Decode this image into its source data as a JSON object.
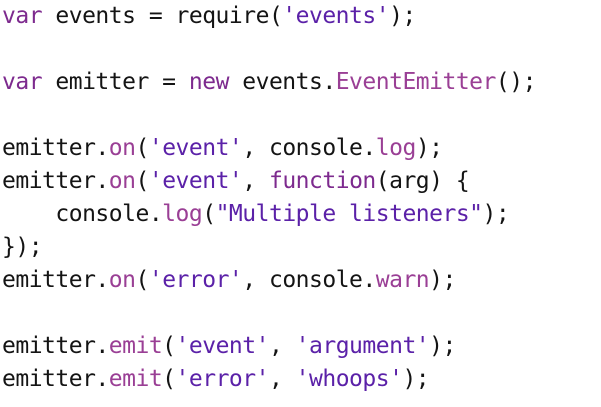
{
  "colors": {
    "background": "#ffffff",
    "plain": "#141414",
    "keyword": "#7d2a8e",
    "string": "#5b21a8",
    "member": "#9a3f95"
  },
  "code": {
    "lines": [
      [
        {
          "t": "kw",
          "v": "var"
        },
        {
          "t": "plain",
          "v": " events = require("
        },
        {
          "t": "str",
          "v": "'events'"
        },
        {
          "t": "plain",
          "v": ");"
        }
      ],
      [],
      [
        {
          "t": "kw",
          "v": "var"
        },
        {
          "t": "plain",
          "v": " emitter = "
        },
        {
          "t": "kw",
          "v": "new"
        },
        {
          "t": "plain",
          "v": " events."
        },
        {
          "t": "mem",
          "v": "EventEmitter"
        },
        {
          "t": "plain",
          "v": "();"
        }
      ],
      [],
      [
        {
          "t": "plain",
          "v": "emitter."
        },
        {
          "t": "mem",
          "v": "on"
        },
        {
          "t": "plain",
          "v": "("
        },
        {
          "t": "str",
          "v": "'event'"
        },
        {
          "t": "plain",
          "v": ", console."
        },
        {
          "t": "mem",
          "v": "log"
        },
        {
          "t": "plain",
          "v": ");"
        }
      ],
      [
        {
          "t": "plain",
          "v": "emitter."
        },
        {
          "t": "mem",
          "v": "on"
        },
        {
          "t": "plain",
          "v": "("
        },
        {
          "t": "str",
          "v": "'event'"
        },
        {
          "t": "plain",
          "v": ", "
        },
        {
          "t": "kw",
          "v": "function"
        },
        {
          "t": "plain",
          "v": "(arg) {"
        }
      ],
      [
        {
          "t": "plain",
          "v": "    console."
        },
        {
          "t": "mem",
          "v": "log"
        },
        {
          "t": "plain",
          "v": "("
        },
        {
          "t": "str",
          "v": "\"Multiple listeners\""
        },
        {
          "t": "plain",
          "v": ");"
        }
      ],
      [
        {
          "t": "plain",
          "v": "});"
        }
      ],
      [
        {
          "t": "plain",
          "v": "emitter."
        },
        {
          "t": "mem",
          "v": "on"
        },
        {
          "t": "plain",
          "v": "("
        },
        {
          "t": "str",
          "v": "'error'"
        },
        {
          "t": "plain",
          "v": ", console."
        },
        {
          "t": "mem",
          "v": "warn"
        },
        {
          "t": "plain",
          "v": ");"
        }
      ],
      [],
      [
        {
          "t": "plain",
          "v": "emitter."
        },
        {
          "t": "mem",
          "v": "emit"
        },
        {
          "t": "plain",
          "v": "("
        },
        {
          "t": "str",
          "v": "'event'"
        },
        {
          "t": "plain",
          "v": ", "
        },
        {
          "t": "str",
          "v": "'argument'"
        },
        {
          "t": "plain",
          "v": ");"
        }
      ],
      [
        {
          "t": "plain",
          "v": "emitter."
        },
        {
          "t": "mem",
          "v": "emit"
        },
        {
          "t": "plain",
          "v": "("
        },
        {
          "t": "str",
          "v": "'error'"
        },
        {
          "t": "plain",
          "v": ", "
        },
        {
          "t": "str",
          "v": "'whoops'"
        },
        {
          "t": "plain",
          "v": ");"
        }
      ]
    ]
  }
}
